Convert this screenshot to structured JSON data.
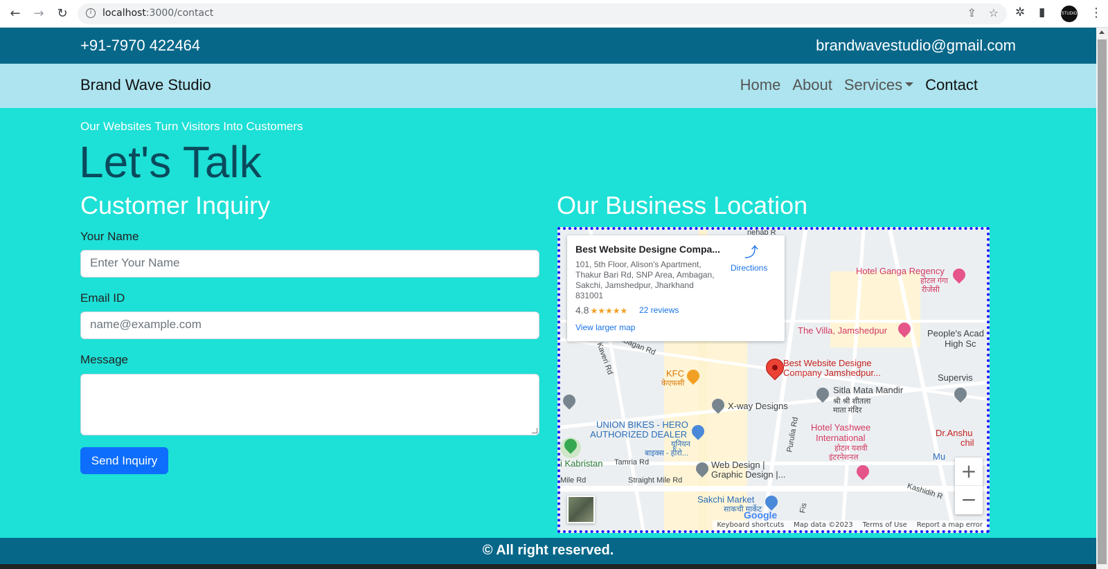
{
  "browser": {
    "url_host": "localhost",
    "url_path": ":3000/contact"
  },
  "topbar": {
    "phone": "+91-7970 422464",
    "email": "brandwavestudio@gmail.com"
  },
  "navbar": {
    "brand": "Brand Wave Studio",
    "links": [
      {
        "label": "Home",
        "active": false
      },
      {
        "label": "About",
        "active": false
      },
      {
        "label": "Services",
        "active": false,
        "dropdown": true
      },
      {
        "label": "Contact",
        "active": true
      }
    ]
  },
  "hero": {
    "tagline": "Our Websites Turn Visitors Into Customers",
    "headline": "Let's Talk"
  },
  "inquiry": {
    "title": "Customer Inquiry",
    "name_label": "Your Name",
    "name_placeholder": "Enter Your Name",
    "email_label": "Email ID",
    "email_placeholder": "name@example.com",
    "message_label": "Message",
    "message_value": "",
    "submit_label": "Send Inquiry"
  },
  "location": {
    "title": "Our Business Location",
    "card": {
      "place_name": "Best Website Designe Compa...",
      "address": "101, 5th Floor, Alison's Apartment, Thakur Bari Rd, SNP Area, Ambagan, Sakchi, Jamshedpur, Jharkhand 831001",
      "rating": "4.8",
      "stars": "★★★★★",
      "reviews": "22 reviews",
      "larger_map": "View larger map",
      "directions": "Directions"
    },
    "map_labels": {
      "hotel_ganga": "Hotel Ganga Regency",
      "hotel_ganga_hi": "होटल गंगा",
      "hotel_ganga_hi2": "रीजेंसी",
      "villa": "The Villa, Jamshedpur",
      "peoples_acad": "People's Acad",
      "high_sc": "High Sc",
      "pin_title_1": "Best Website Designe",
      "pin_title_2": "Company Jamshedpur...",
      "kfc": "KFC",
      "kfc_hi": "केएफसी",
      "sitla_1": "Sitla Mata Mandir",
      "sitla_2": "श्री श्री शीतला",
      "sitla_3": "माता मंदिर",
      "supervis": "Supervis",
      "xway": "X-way Designs",
      "union_1": "UNION BIKES - HERO",
      "union_2": "AUTHORIZED DEALER",
      "union_3": "यूनियन",
      "union_4": "बाइक्स - हीरो...",
      "yashwee_1": "Hotel Yashwee",
      "yashwee_2": "International",
      "yashwee_3": "होटल यशवी",
      "yashwee_4": "इंटरनेशनल",
      "anshu_1": "Dr.Anshu",
      "anshu_2": "chil",
      "mu": "Mu",
      "kabristan": "i Kabristan",
      "tamria": "Tamria Rd",
      "webdesign_1": "Web Design |",
      "webdesign_2": "Graphic Design |...",
      "mile_rd": "Mile Rd",
      "straight_mile": "Straight Mile Rd",
      "sakchi_market": "Sakchi Market",
      "sakchi_market_hi": "साकची मार्केट",
      "kashidih": "Kashidih R",
      "ambagan_rd": "Ambagan Rd",
      "kaveri_rd": "Kaveri Rd",
      "purulia_rd": "Purulia Rd",
      "nehab": "nehab R",
      "fis": "Fis"
    },
    "zoom_in": "+",
    "zoom_out": "−",
    "google": "Google",
    "attribution": [
      "Keyboard shortcuts",
      "Map data ©2023",
      "Terms of Use",
      "Report a map error"
    ]
  },
  "footer": {
    "copyright": "© All right reserved."
  }
}
